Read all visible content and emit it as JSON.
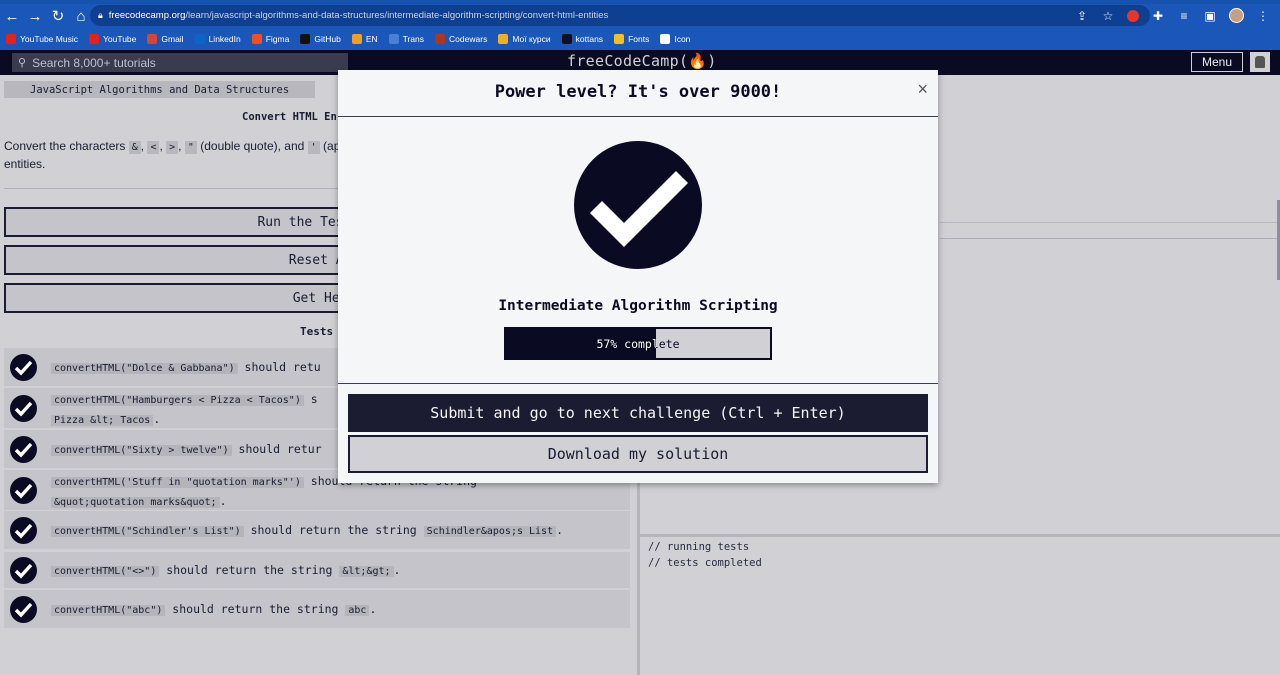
{
  "browser": {
    "url_domain": "freecodecamp.org",
    "url_path": "/learn/javascript-algorithms-and-data-structures/intermediate-algorithm-scripting/convert-html-entities",
    "bookmarks": [
      {
        "label": "YouTube Music",
        "icon": "youtube-music-icon",
        "color": "#e62117"
      },
      {
        "label": "YouTube",
        "icon": "youtube-icon",
        "color": "#e62117"
      },
      {
        "label": "Gmail",
        "icon": "gmail-icon",
        "color": "#d44638"
      },
      {
        "label": "LinkedIn",
        "icon": "linkedin-icon",
        "color": "#0a66c2"
      },
      {
        "label": "Figma",
        "icon": "figma-icon",
        "color": "#f24e1e"
      },
      {
        "label": "GitHub",
        "icon": "github-icon",
        "color": "#111111"
      },
      {
        "label": "EN",
        "icon": "translate-icon",
        "color": "#f0a020"
      },
      {
        "label": "Trans",
        "icon": "trans-icon",
        "color": "#4a7fd6"
      },
      {
        "label": "Codewars",
        "icon": "codewars-icon",
        "color": "#b1361e"
      },
      {
        "label": "Мої курси",
        "icon": "courses-icon",
        "color": "#f0b020"
      },
      {
        "label": "kottans",
        "icon": "github-icon",
        "color": "#111111"
      },
      {
        "label": "Fonts",
        "icon": "fonts-icon",
        "color": "#f0c020"
      },
      {
        "label": "Icon",
        "icon": "icon-icon",
        "color": "#ffffff"
      }
    ]
  },
  "nav": {
    "search_placeholder": "Search 8,000+ tutorials",
    "brand": "freeCodeCamp(🔥)",
    "menu_label": "Menu"
  },
  "challenge": {
    "breadcrumb": "JavaScript Algorithms and Data Structures",
    "title": "Convert HTML En",
    "description_start": "Convert the characters",
    "entities": [
      "&",
      "<",
      ">",
      "\"",
      "'"
    ],
    "description_mid": "(double quote), and",
    "description_end": "(apos",
    "description_line2": "entities.",
    "run_tests": "Run the Tests (Ct",
    "reset": "Reset All",
    "get_help": "Get Help",
    "tests_heading": "Tests"
  },
  "tests": [
    {
      "code": "convertHTML(\"Dolce & Gabbana\")",
      "text": " should retu"
    },
    {
      "code": "convertHTML(\"Hamburgers < Pizza < Tacos\")",
      "text": " s",
      "line2_code": "Pizza &lt; Tacos",
      "line2_text": "."
    },
    {
      "code": "convertHTML(\"Sixty > twelve\")",
      "text": " should retur"
    },
    {
      "code": "convertHTML('Stuff in \"quotation marks\"')",
      "text": " should return the string ",
      "line2_code": "&quot;quotation marks&quot;",
      "line2_text": "."
    },
    {
      "code": "convertHTML(\"Schindler's List\")",
      "text": " should return the string ",
      "result": "Schindler&apos;s List",
      "end": "."
    },
    {
      "code": "convertHTML(\"<>\")",
      "text": " should return the string ",
      "result": "&lt;&gt;",
      "end": "."
    },
    {
      "code": "convertHTML(\"abc\")",
      "text": " should return the string ",
      "result": "abc",
      "end": "."
    }
  ],
  "console": [
    "// running tests",
    "// tests completed"
  ],
  "modal": {
    "title": "Power level? It's over 9000!",
    "close": "×",
    "block_name": "Intermediate Algorithm Scripting",
    "progress_percent": 57,
    "progress_label": "57% complete",
    "submit_label": "Submit and go to next challenge (Ctrl + Enter)",
    "download_label": "Download my solution"
  },
  "colors": {
    "dark": "#0a0a23",
    "secondary": "#1b1b32",
    "panel": "#d0d0d5",
    "chrome_blue": "#1a57b8"
  }
}
